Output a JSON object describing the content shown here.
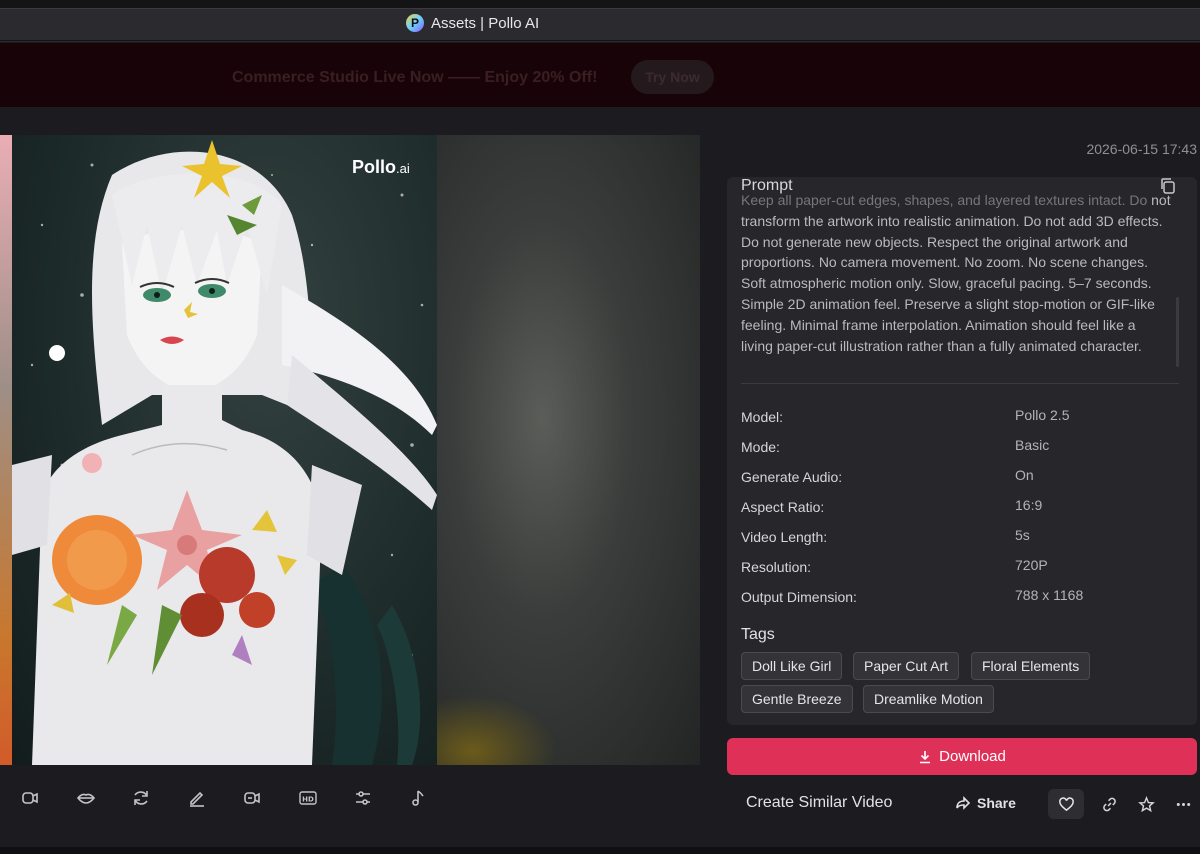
{
  "window": {
    "title": "Assets | Pollo AI"
  },
  "promo": {
    "text": "Commerce Studio Live Now —— Enjoy 20% Off!",
    "button": "Try Now"
  },
  "media": {
    "watermark_brand": "Pollo",
    "watermark_suffix": ".ai"
  },
  "toolbar": {
    "tools": [
      "lip-sync-icon",
      "lips-icon",
      "refresh-icon",
      "edit-icon",
      "swap-icon",
      "hd-icon",
      "adjust-icon",
      "music-icon"
    ]
  },
  "asset": {
    "timestamp": "2026-06-15 17:43",
    "prompt_label": "Prompt",
    "prompt_text_top": "Keep all paper-cut edges, shapes, and layered textures intact. Do",
    "prompt_text": "not transform the artwork into realistic animation. Do not add 3D effects. Do not generate new objects. Respect the original artwork and proportions. No camera movement. No zoom. No scene changes. Soft atmospheric motion only. Slow, graceful pacing. 5–7 seconds. Simple 2D animation feel. Preserve a slight stop-motion or GIF-like feeling. Minimal frame interpolation. Animation should feel like a living paper-cut illustration rather than a fully animated character.",
    "details": [
      {
        "key": "Model:",
        "value": "Pollo 2.5"
      },
      {
        "key": "Mode:",
        "value": "Basic"
      },
      {
        "key": "Generate Audio:",
        "value": "On"
      },
      {
        "key": "Aspect Ratio:",
        "value": "16:9"
      },
      {
        "key": "Video Length:",
        "value": "5s"
      },
      {
        "key": "Resolution:",
        "value": "720P"
      },
      {
        "key": "Output Dimension:",
        "value": "788 x 1168"
      }
    ],
    "tags_label": "Tags",
    "tags": [
      "Doll Like Girl",
      "Paper Cut Art",
      "Floral Elements",
      "Gentle Breeze",
      "Dreamlike Motion"
    ]
  },
  "actions": {
    "download": "Download",
    "create_similar": "Create Similar Video",
    "share": "Share"
  },
  "colors": {
    "accent": "#df3158",
    "panel": "#26262b",
    "background": "#1c1c20"
  }
}
